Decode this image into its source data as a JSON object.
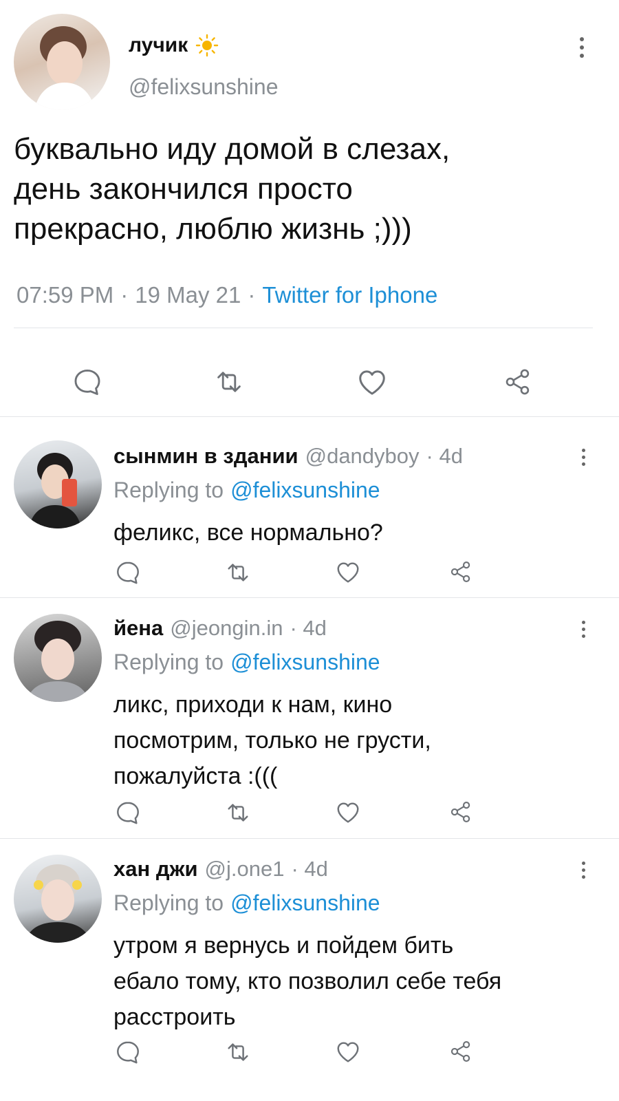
{
  "main_tweet": {
    "display_name": "лучик",
    "handle": "@felixsunshine",
    "text_lines": [
      "буквально иду домой в слезах,",
      "день закончился просто",
      "прекрасно, люблю жизнь ;)))"
    ],
    "time": "07:59 PM",
    "date": "19 May 21",
    "sep": "·",
    "source": "Twitter for Iphone",
    "actions": [
      "reply-icon",
      "retweet-icon",
      "like-icon",
      "share-icon"
    ]
  },
  "replies": [
    {
      "display_name": "сынмин в здании",
      "handle": "@dandyboy",
      "age": "· 4d",
      "replying_prefix": "Replying to",
      "replying_to": "@felixsunshine",
      "text_lines": [
        "феликс, все нормально?"
      ]
    },
    {
      "display_name": "йена",
      "handle": "@jeongin.in",
      "age": "· 4d",
      "replying_prefix": "Replying to",
      "replying_to": "@felixsunshine",
      "text_lines": [
        "ликс, приходи к нам, кино",
        "посмотрим, только не грусти,",
        "пожалуйста :((("
      ]
    },
    {
      "display_name": "хан джи",
      "handle": "@j.one1",
      "age": "· 4d",
      "replying_prefix": "Replying to",
      "replying_to": "@felixsunshine",
      "text_lines": [
        "утром я вернусь и пойдем бить",
        "ебало тому, кто позволил себе тебя",
        "расстроить"
      ]
    }
  ],
  "colors": {
    "link": "#1d8fd6",
    "muted": "#8a8f94",
    "sun": "#f7b500"
  }
}
